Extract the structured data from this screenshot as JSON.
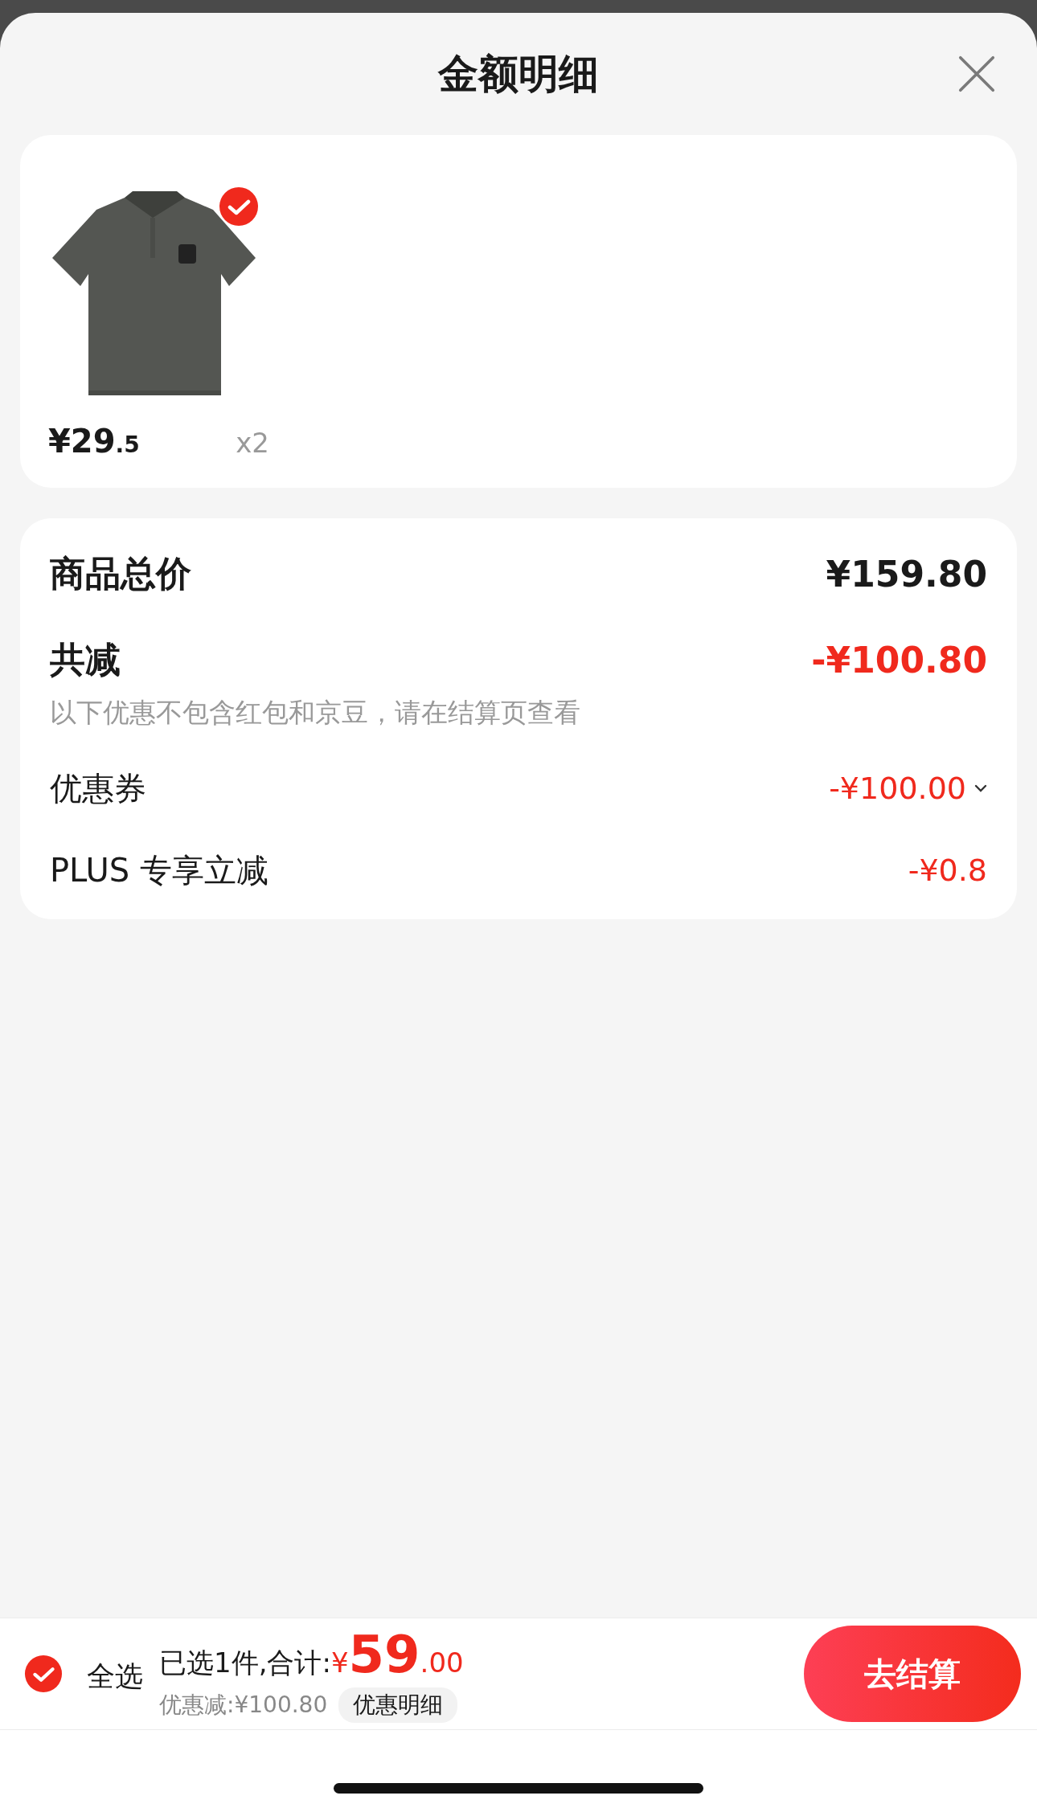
{
  "sheet": {
    "title": "金额明细"
  },
  "products": [
    {
      "kind": "picture",
      "selected": true,
      "price_main": "¥29",
      "price_decimal": ".5",
      "quantity": "x2"
    }
  ],
  "summary": {
    "total": {
      "label": "商品总价",
      "value": "¥159.80"
    },
    "reduction": {
      "label": "共减",
      "value": "-¥100.80",
      "note": "以下优惠不包含红包和京豆，请在结算页查看"
    },
    "discounts": [
      {
        "label": "优惠券",
        "value": "-¥100.00",
        "expandable": true
      },
      {
        "label": "PLUS 专享立减",
        "value": "-¥0.8",
        "expandable": false
      }
    ]
  },
  "footer": {
    "select_all": {
      "label": "全选",
      "checked": true
    },
    "selected_text": "已选1件,合计:",
    "currency": "¥",
    "total_main": "59",
    "total_decimal": ".00",
    "discount_text": "优惠减:¥100.80",
    "detail_link": "优惠明细",
    "checkout": "去结算"
  }
}
